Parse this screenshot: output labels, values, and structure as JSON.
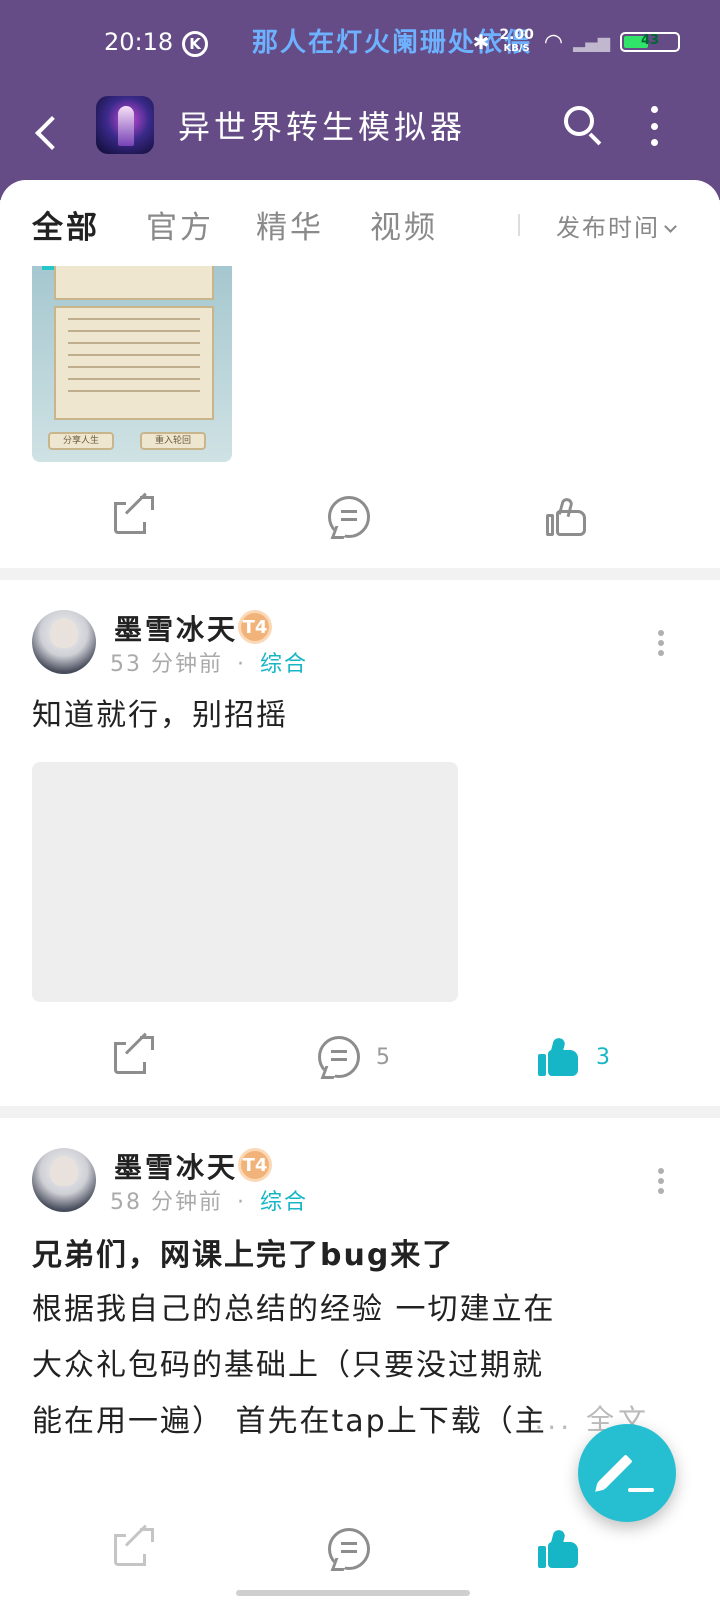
{
  "status_bar": {
    "time": "20:18",
    "k_icon": "K",
    "marquee": "那人在灯火阑珊处依偎",
    "speed_value": "2.00",
    "speed_unit": "KB/S",
    "battery": "43"
  },
  "app_bar": {
    "title": "异世界转生模拟器"
  },
  "tabs": [
    {
      "label": "全部",
      "active": true
    },
    {
      "label": "官方"
    },
    {
      "label": "精华"
    },
    {
      "label": "视频"
    }
  ],
  "sort_label": "发布时间",
  "thumb": {
    "button_1": "分享人生",
    "button_2": "重入轮回"
  },
  "posts": [
    {
      "author": "墨雪冰天",
      "level": "T4",
      "time": "53 分钟前",
      "dot": "·",
      "category": "综合",
      "content": "知道就行，别招摇",
      "comments": "5",
      "likes": "3"
    },
    {
      "author": "墨雪冰天",
      "level": "T4",
      "time": "58 分钟前",
      "dot": "·",
      "category": "综合",
      "title": "兄弟们，网课上完了bug来了",
      "content": "根据我自己的总结的经验 一切建立在大众礼包码的基础上（只要没过期就能在用一遍） 首先在tap上下载（主要",
      "more": "... 全文"
    }
  ],
  "colors": {
    "header_bg": "#654c86",
    "accent": "#17b6c6",
    "fab": "#25bfd1"
  },
  "icons": [
    "back-icon",
    "search-icon",
    "more-icon",
    "share-icon",
    "comment-icon",
    "like-icon",
    "edit-icon"
  ]
}
